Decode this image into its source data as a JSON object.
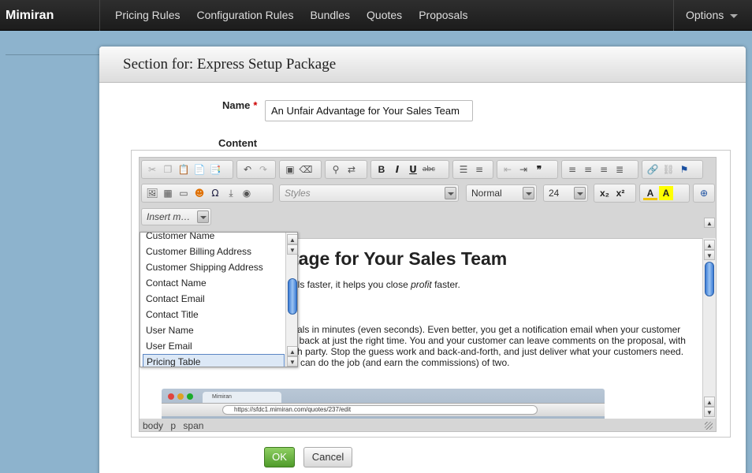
{
  "nav": {
    "brand": "Mimiran",
    "links": [
      "Pricing Rules",
      "Configuration Rules",
      "Bundles",
      "Quotes",
      "Proposals"
    ],
    "options": "Options"
  },
  "panel": {
    "title": "Section for: Express Setup Package",
    "name_label": "Name",
    "required_mark": "*",
    "name_value": "An Unfair Advantage for Your Sales Team",
    "content_label": "Content"
  },
  "editor": {
    "styles_placeholder": "Styles",
    "format_value": "Normal",
    "size_value": "24",
    "insert_placeholder": "Insert m…",
    "insert_items": [
      "Customer Name",
      "Customer Billing Address",
      "Customer Shipping Address",
      "Contact Name",
      "Contact Email",
      "Contact Title",
      "User Name",
      "User Email",
      "Pricing Table"
    ],
    "selected_item": "Pricing Table",
    "doc_heading": "tage for Your Sales Team",
    "doc_line1_a": "als faster, it helps you close ",
    "doc_line1_em": "profit",
    "doc_line1_b": " faster.",
    "doc_para": "sals in minutes (even seconds). Even better, you get a notification email when your customer\nll back at just the right time. You and your customer can leave comments on the proposal, with\nch party. Stop the guess work and back-and-forth, and just deliver what your customers need.\no can do the job (and earn the commissions) of two.",
    "shot_tab": "Mimiran",
    "shot_url": "https://sfdc1.mimiran.com/quotes/237/edit",
    "status_path": [
      "body",
      "p",
      "span"
    ]
  },
  "buttons": {
    "ok": "OK",
    "cancel": "Cancel"
  }
}
